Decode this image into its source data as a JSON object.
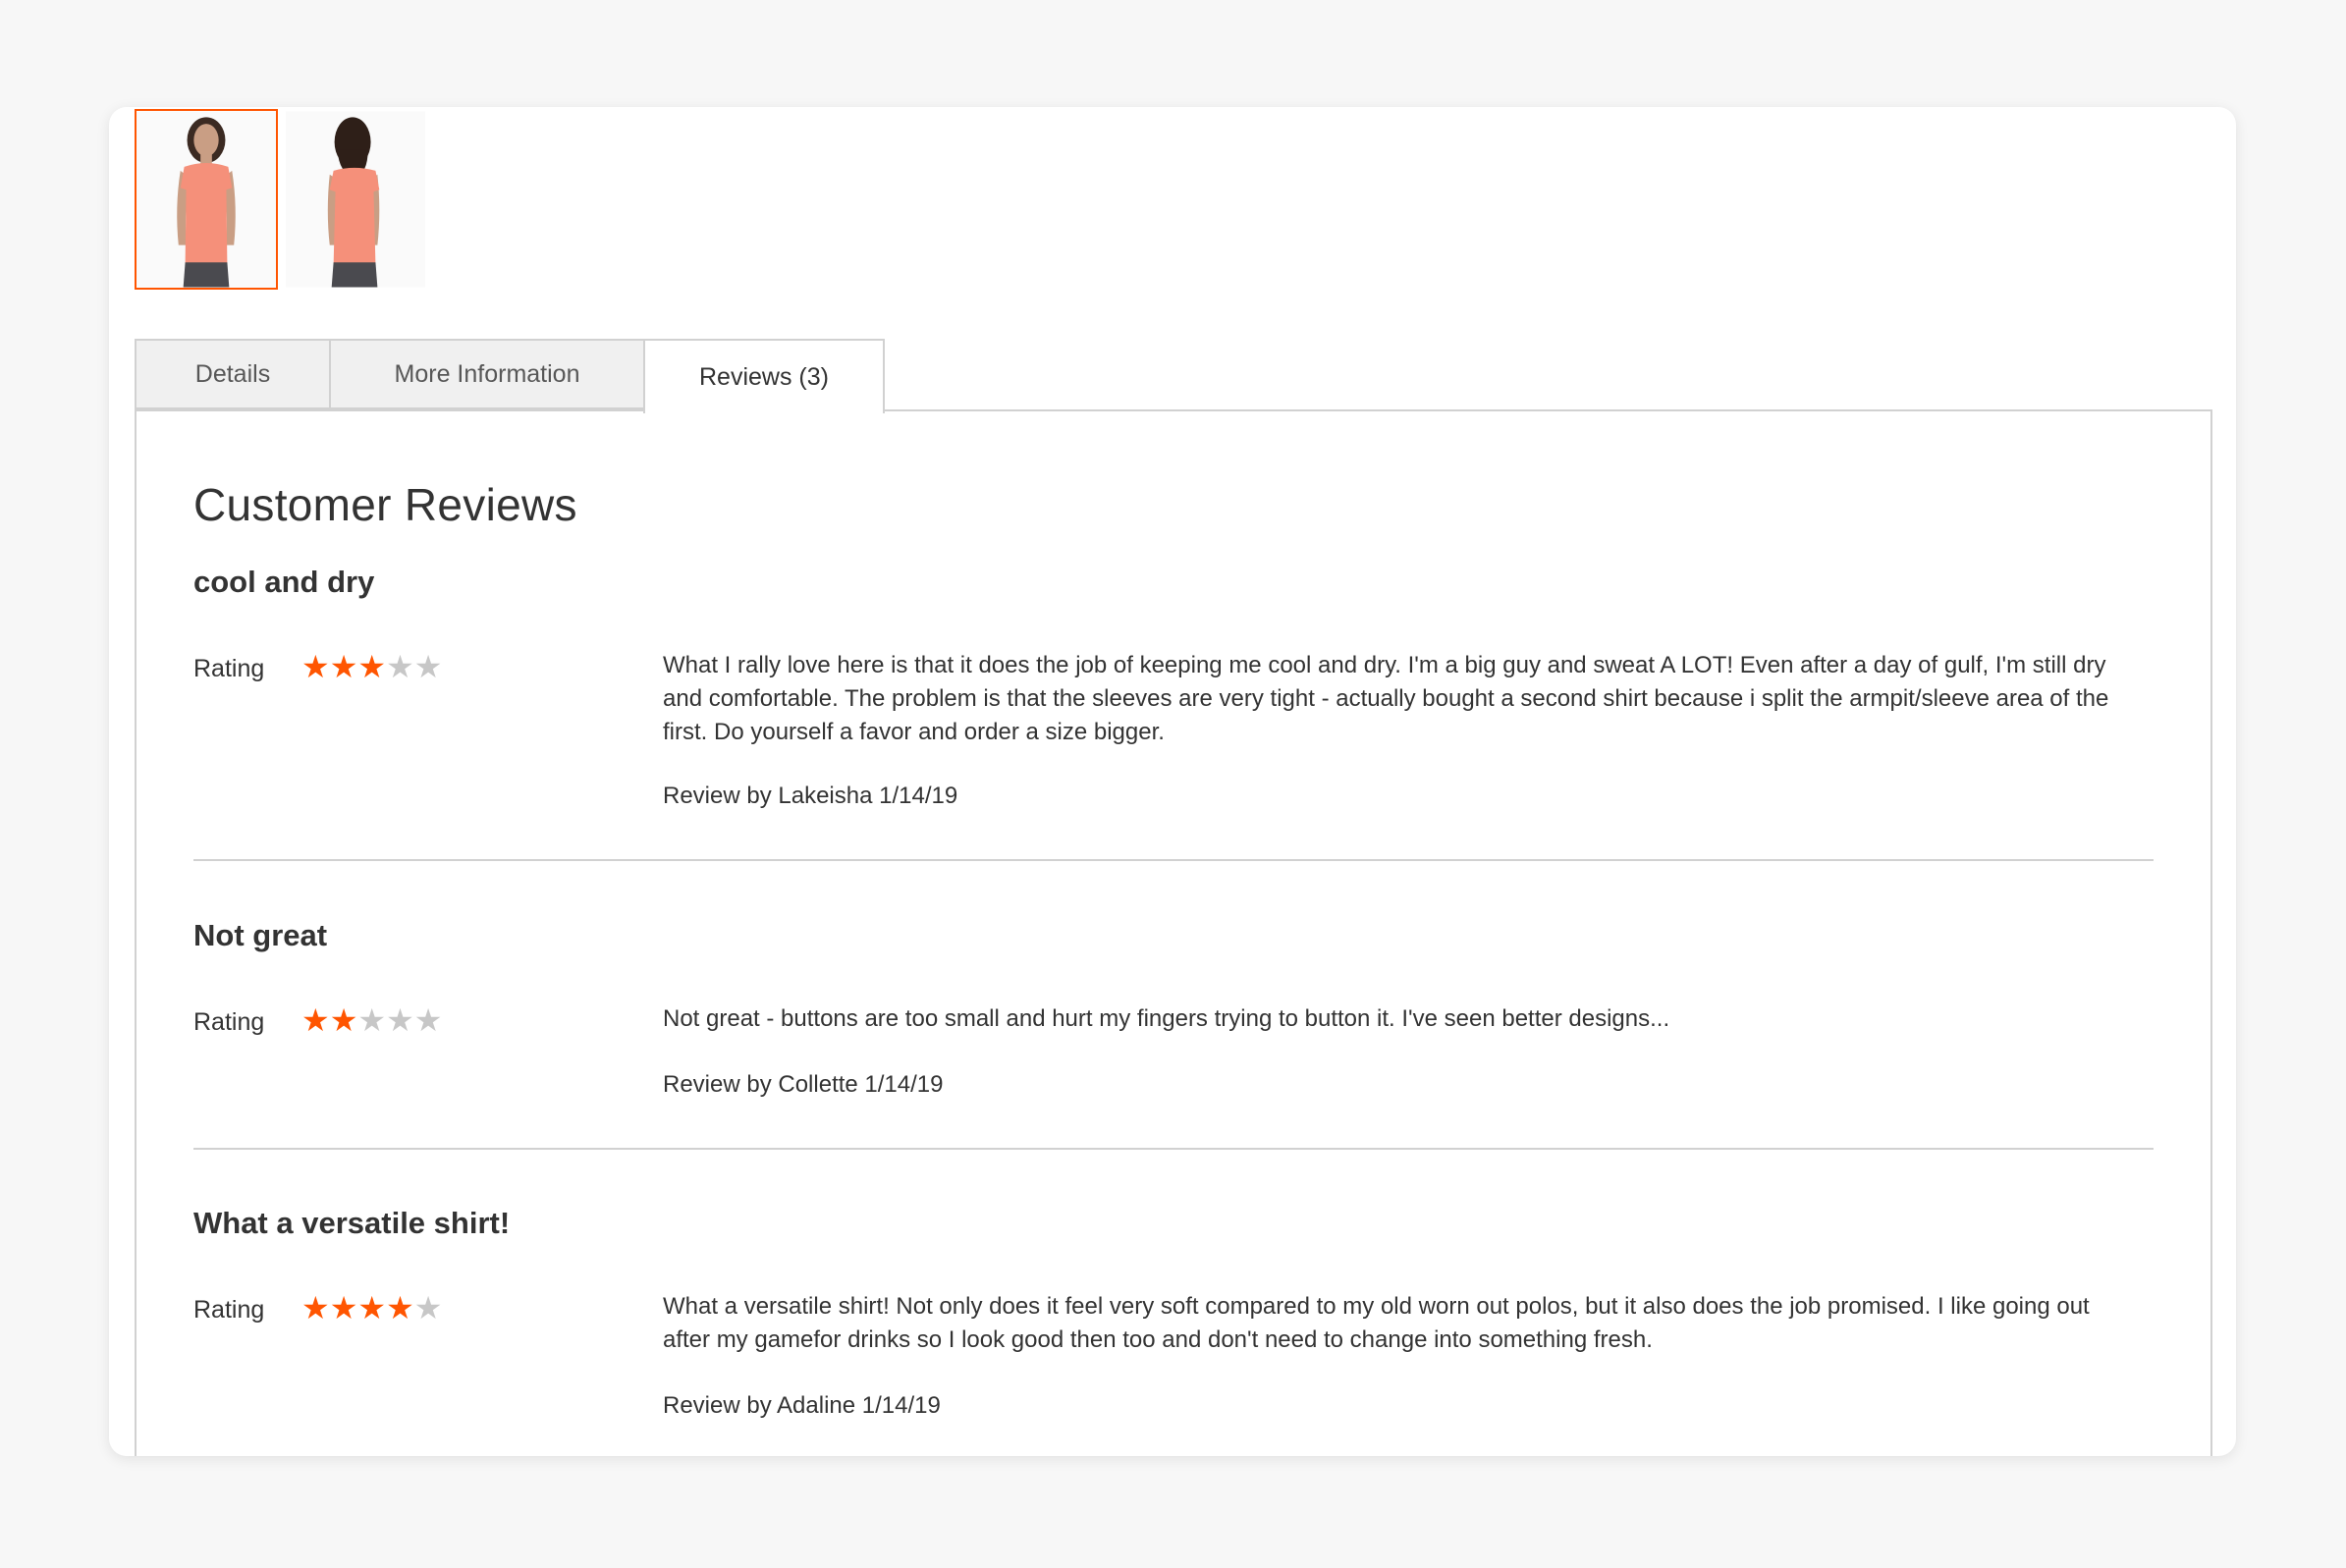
{
  "colors": {
    "accent": "#ff5501",
    "star_off": "#c7c7c7",
    "border": "#d1d1d1",
    "tab_inactive_bg": "#f0f0f0"
  },
  "gallery": {
    "thumbnails": [
      {
        "alt": "front view",
        "active": true
      },
      {
        "alt": "back view",
        "active": false
      }
    ]
  },
  "tabs": [
    {
      "label": "Details",
      "active": false
    },
    {
      "label": "More Information",
      "active": false
    },
    {
      "label": "Reviews (3)",
      "active": true
    }
  ],
  "reviews_section": {
    "title": "Customer Reviews",
    "rating_label": "Rating",
    "reviews": [
      {
        "title": "cool and dry",
        "stars": 3,
        "max_stars": 5,
        "text": "What I rally love here is that it does the job of keeping me cool and dry. I'm a big guy and sweat A LOT! Even after a day of gulf, I'm still dry and comfortable. The problem is that the sleeves are very tight - actually bought a second shirt because i split the armpit/sleeve area of the first. Do yourself a favor and order a size bigger.",
        "meta": "Review by Lakeisha 1/14/19"
      },
      {
        "title": "Not great",
        "stars": 2,
        "max_stars": 5,
        "text": "Not great - buttons are too small and hurt my fingers trying to button it. I've seen better designs...",
        "meta": "Review by Collette 1/14/19"
      },
      {
        "title": "What a versatile shirt!",
        "stars": 4,
        "max_stars": 5,
        "text": "What a versatile shirt! Not only does it feel very soft compared to my old worn out polos, but it also does the job promised. I like going out after my gamefor drinks so I look good then too and don't need to change into something fresh.",
        "meta": "Review by Adaline 1/14/19"
      }
    ]
  }
}
